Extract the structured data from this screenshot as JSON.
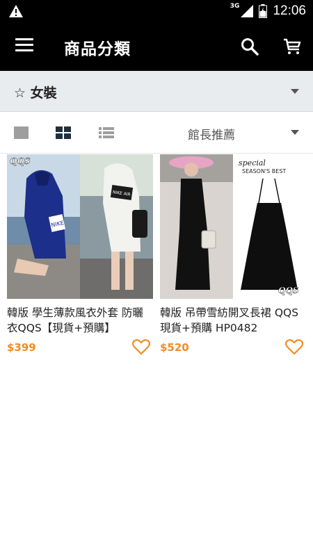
{
  "status_bar": {
    "network": "3G",
    "time": "12:06"
  },
  "app_bar": {
    "title": "商品分類"
  },
  "category": {
    "star": "☆",
    "name": "女裝"
  },
  "view_bar": {
    "sort_label": "館長推薦"
  },
  "products": [
    {
      "name": "韓版 學生薄款風衣外套 防曬衣QQS【現貨+預購】",
      "price": "$399",
      "watermark": "QQS",
      "print_text": "NIKE",
      "print_text_2": "NIKE AIR"
    },
    {
      "name": "韓版 吊帶雪紡開叉長裙 QQS  現貨+預購  HP0482",
      "price": "$520",
      "watermark": "QQS",
      "tag_line1": "special",
      "tag_line2": "SEASON'S BEST"
    }
  ],
  "colors": {
    "accent": "#f08c22",
    "app_bar": "#000000",
    "category_bg": "#e8ecef"
  }
}
